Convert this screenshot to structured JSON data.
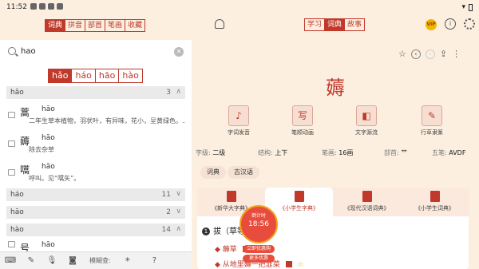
{
  "status": {
    "time": "11:52"
  },
  "left_tabs": [
    "词典",
    "拼音",
    "部首",
    "笔画",
    "收藏"
  ],
  "search": {
    "query": "hao"
  },
  "tones": [
    "hǎo",
    "háo",
    "hāo",
    "hào"
  ],
  "groups": [
    {
      "label": "hǎo",
      "count": "3",
      "chev": "∧",
      "expanded": true
    },
    {
      "label": "háo",
      "count": "11",
      "chev": "∨"
    },
    {
      "label": "hāo",
      "count": "2",
      "chev": "∨"
    },
    {
      "label": "hào",
      "count": "14",
      "chev": "∧"
    }
  ],
  "entries": [
    {
      "char": "蒿",
      "pinyin": "hāo",
      "def": "二年生草本植物，羽状叶，有异味，花小，呈黄绿色。…"
    },
    {
      "char": "薅",
      "pinyin": "hāo",
      "def": "除去杂草"
    },
    {
      "char": "嚆",
      "pinyin": "hāo",
      "def": "呼叫。见“嚆矢”。"
    },
    {
      "char": "号",
      "pinyin": "hāo",
      "def": ""
    }
  ],
  "toolbar": {
    "mode_label": "模糊查:",
    "star": "*",
    "help": "?"
  },
  "right": {
    "top_tabs": [
      "学习",
      "词典",
      "故事"
    ],
    "vip": "VIP",
    "info": "i",
    "character": "薅",
    "features": [
      {
        "label": "字词发音",
        "glyph": "♪"
      },
      {
        "label": "笔顺动画",
        "glyph": "写"
      },
      {
        "label": "文字源流",
        "glyph": "◧"
      },
      {
        "label": "行草隶篆",
        "glyph": "✎"
      }
    ],
    "meta": {
      "level_label": "字级:",
      "level": "二级",
      "struct_label": "结构:",
      "struct": "上下",
      "strokes_label": "笔画:",
      "strokes": "16画",
      "radical_label": "部首:",
      "radical": "艹",
      "wubi_label": "五笔:",
      "wubi": "AVDF"
    },
    "pills": [
      "词典",
      "古汉语"
    ],
    "dicts": [
      "《新华大字典》",
      "《小学生字典》",
      "《现代汉语词典》",
      "《小学生词典》"
    ],
    "sense_number": "1",
    "sense": "拔（草等）:",
    "examples": [
      "◆ 薅草",
      "◆ 从地里薅一把韭菜"
    ],
    "promo": {
      "label": "倒计时",
      "time": "18:56",
      "btn1": "立即优惠购",
      "btn2": "更多优惠"
    }
  }
}
